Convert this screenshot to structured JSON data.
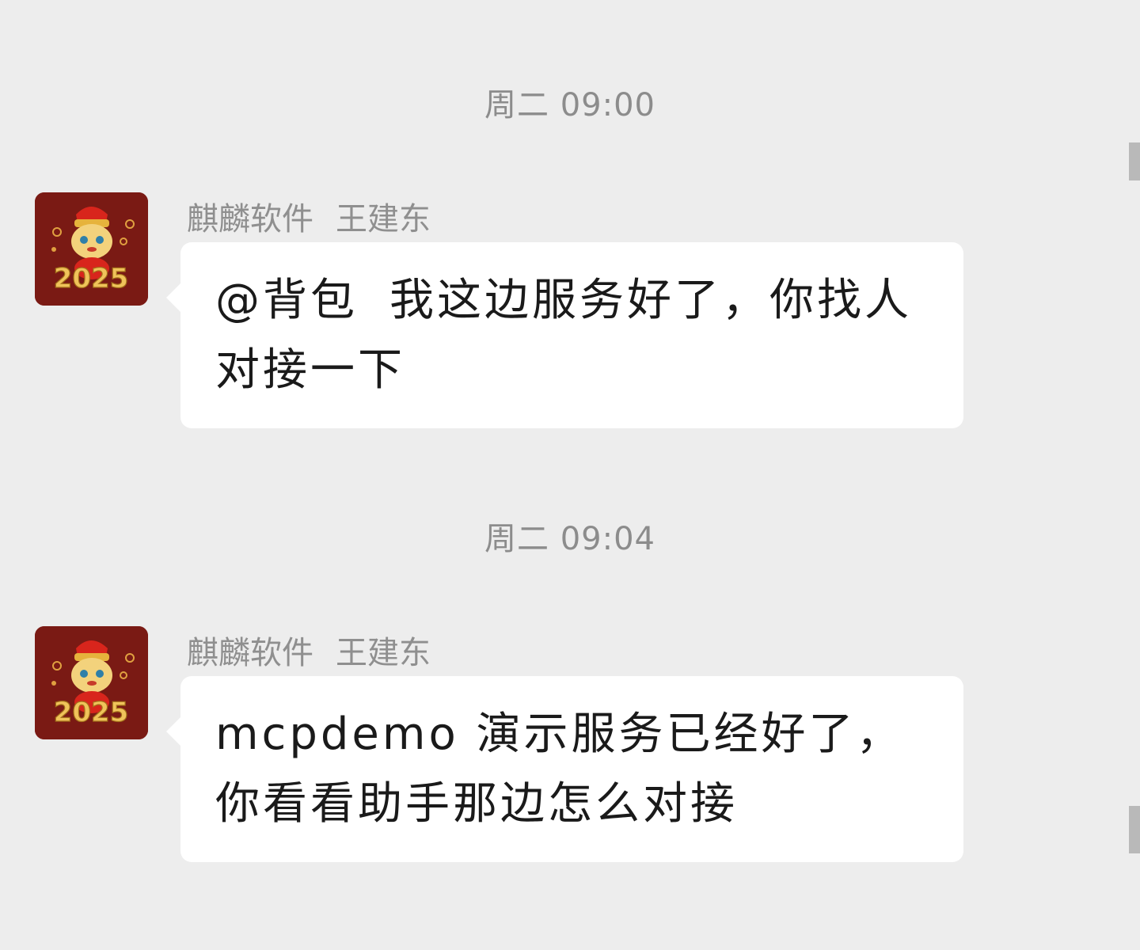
{
  "messages": [
    {
      "timestamp": "周二 09:00",
      "sender_org": "麒麟软件",
      "sender_name": "王建东",
      "mention": "@背包",
      "text": "我这边服务好了，你找人对接一下"
    },
    {
      "timestamp": "周二 09:04",
      "sender_org": "麒麟软件",
      "sender_name": "王建东",
      "mention": "",
      "text": "mcpdemo 演示服务已经好了，你看看助手那边怎么对接"
    }
  ],
  "avatar": {
    "icon": "new-year-2025-avatar-icon",
    "text": "2025",
    "background_color": "#7a1a14"
  },
  "colors": {
    "background": "#ededed",
    "bubble": "#ffffff",
    "meta_text": "#8c8c8c",
    "message_text": "#1a1a1a"
  }
}
